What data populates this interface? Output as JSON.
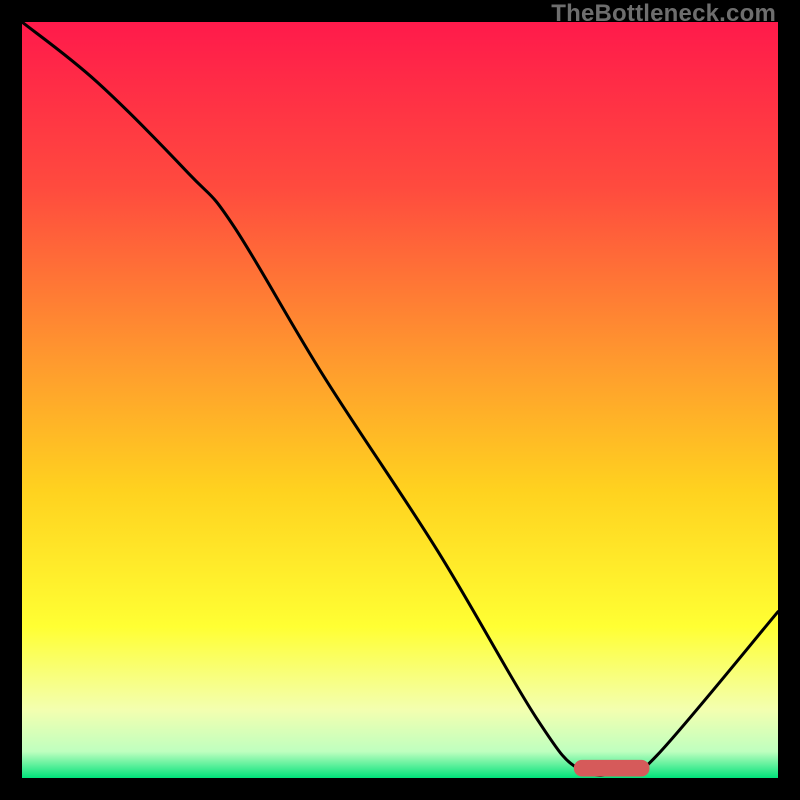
{
  "watermark": "TheBottleneck.com",
  "chart_data": {
    "type": "line",
    "title": "",
    "xlabel": "",
    "ylabel": "",
    "xlim": [
      0,
      100
    ],
    "ylim": [
      0,
      100
    ],
    "grid": false,
    "legend": false,
    "background_gradient": {
      "stops": [
        {
          "pos": 0.0,
          "color": "#ff1a4b"
        },
        {
          "pos": 0.22,
          "color": "#ff4b3e"
        },
        {
          "pos": 0.45,
          "color": "#ff9a2e"
        },
        {
          "pos": 0.62,
          "color": "#ffd21f"
        },
        {
          "pos": 0.8,
          "color": "#ffff33"
        },
        {
          "pos": 0.91,
          "color": "#f3ffb0"
        },
        {
          "pos": 0.965,
          "color": "#bfffbf"
        },
        {
          "pos": 1.0,
          "color": "#00e27a"
        }
      ]
    },
    "series": [
      {
        "name": "bottleneck-curve",
        "color": "#000000",
        "x": [
          0,
          10,
          22,
          28,
          40,
          55,
          68,
          74,
          80,
          84,
          100
        ],
        "y": [
          100,
          92,
          80,
          73,
          53,
          30,
          8,
          1,
          1,
          3,
          22
        ]
      }
    ],
    "marker": {
      "name": "optimal-range",
      "color": "#d65a5a",
      "x_start": 73,
      "x_end": 83,
      "y": 1.3,
      "height": 2.2
    }
  }
}
